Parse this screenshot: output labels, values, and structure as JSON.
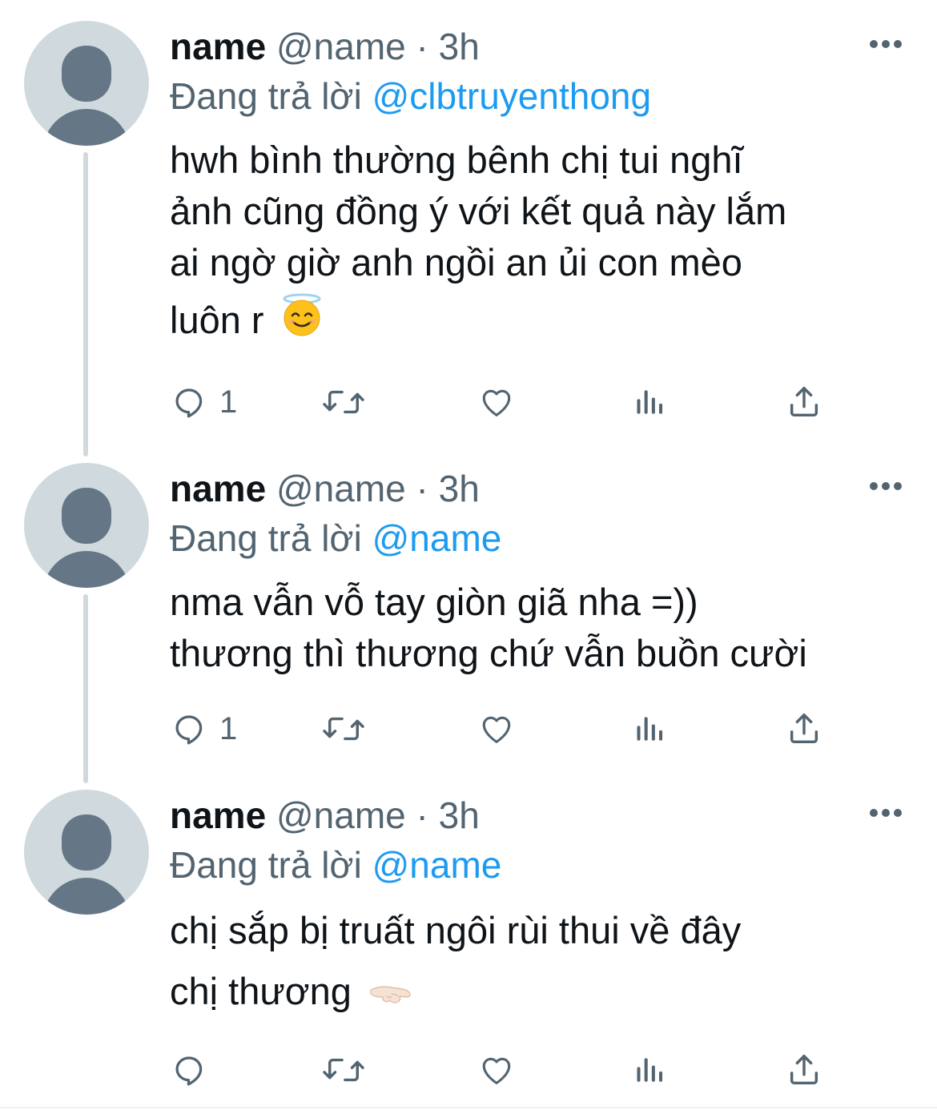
{
  "tweets": [
    {
      "display_name": "name",
      "handle": "@name",
      "separator": "·",
      "time": "3h",
      "reply_prefix": "Đang trả lời",
      "reply_to": "@clbtruyenthong",
      "text_lines": [
        "hwh bình thường bênh chị tui nghĩ",
        "ảnh cũng đồng ý với kết quả này lắm",
        "ai ngờ giờ anh ngồi an ủi con mèo",
        "luôn r"
      ],
      "emoji": "smiling-face-with-halo",
      "reply_count": "1"
    },
    {
      "display_name": "name",
      "handle": "@name",
      "separator": "·",
      "time": "3h",
      "reply_prefix": "Đang trả lời",
      "reply_to": "@name",
      "text_lines": [
        "nma vẫn vỗ tay giòn giã nha =))",
        "thương thì thương chứ vẫn buồn cười"
      ],
      "reply_count": "1"
    },
    {
      "display_name": "name",
      "handle": "@name",
      "separator": "·",
      "time": "3h",
      "reply_prefix": "Đang trả lời",
      "reply_to": "@name",
      "text_lines": [
        "chị sắp bị truất ngôi rùi thui về đây",
        "chị thương"
      ],
      "emoji": "pinched-fingers-hand",
      "reply_count": ""
    }
  ],
  "icons": {
    "reply": "reply-icon",
    "retweet": "retweet-icon",
    "like": "heart-icon",
    "views": "analytics-icon",
    "share": "share-icon",
    "more": "more-icon"
  },
  "colors": {
    "text": "#0f1419",
    "secondary": "#536471",
    "accent": "#1d9bf0",
    "avatar_bg": "#cfd9de",
    "avatar_fg": "#657786"
  }
}
